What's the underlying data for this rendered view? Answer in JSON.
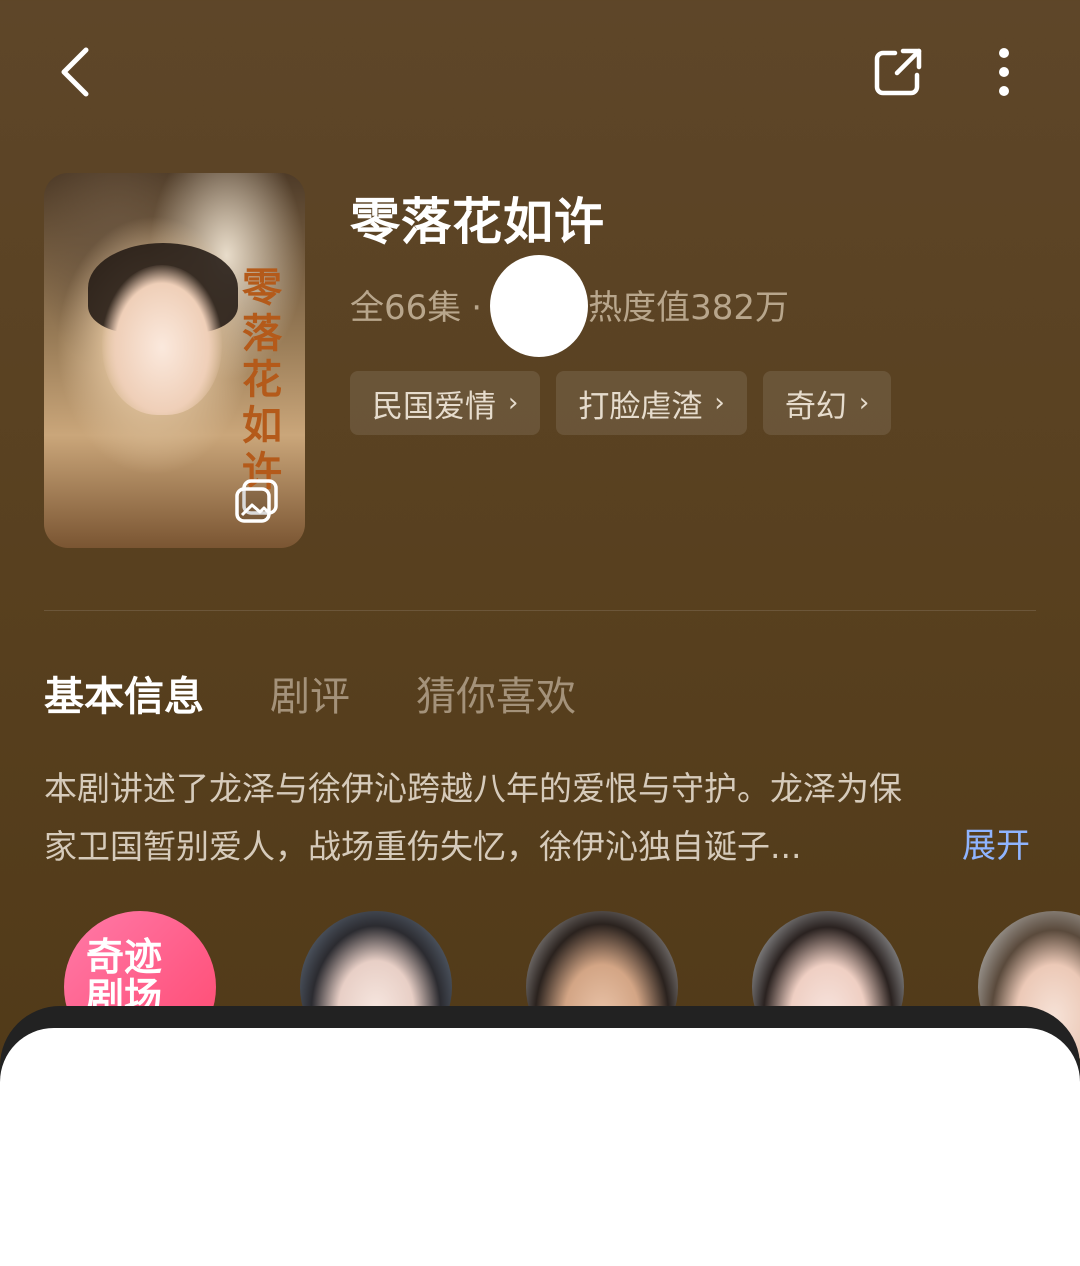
{
  "header": {
    "back_icon": "chevron-left-icon",
    "share_icon": "share-icon",
    "more_icon": "more-vertical-icon"
  },
  "poster": {
    "title_text": "零落花如许",
    "gallery_icon": "gallery-icon"
  },
  "show": {
    "title": "零落花如许",
    "episodes": "全66集",
    "dot": "·",
    "heat": "热度值382万",
    "tags": [
      {
        "label": "民国爱情"
      },
      {
        "label": "打脸虐渣"
      },
      {
        "label": "奇幻"
      }
    ]
  },
  "tabs": [
    {
      "label": "基本信息",
      "active": true
    },
    {
      "label": "剧评",
      "active": false
    },
    {
      "label": "猜你喜欢",
      "active": false
    }
  ],
  "description": {
    "line1": "本剧讲述了龙泽与徐伊沁跨越八年的爱恨与守护。龙泽为保",
    "line2": "家卫国暂别爱人，战场重伤失忆，徐伊沁独自诞子...",
    "expand_label": "展开"
  },
  "cast": {
    "studio_logo_text": "奇迹剧场"
  },
  "colors": {
    "background": "#58401f",
    "accent_link": "#8fb4ff",
    "tag_bg": "rgba(255,255,255,0.10)"
  }
}
